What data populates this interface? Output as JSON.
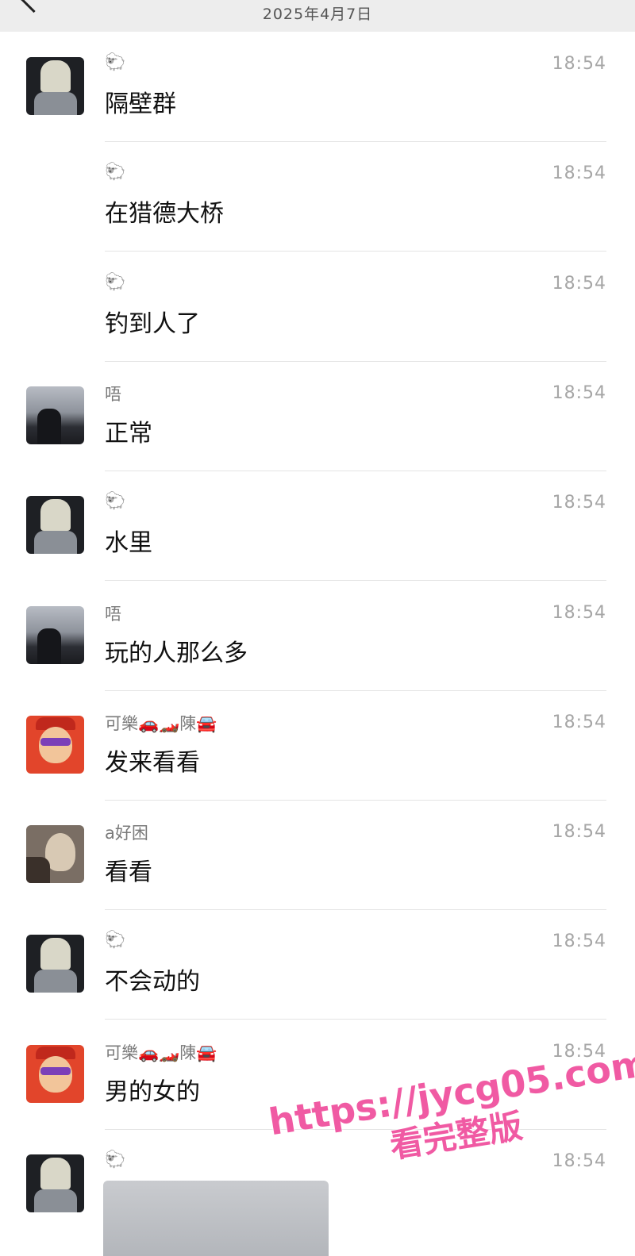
{
  "header": {
    "date": "2025年4月7日"
  },
  "messages": [
    {
      "sender": "🐑",
      "time": "18:54",
      "text": "隔壁群",
      "avatar": "blond",
      "show_avatar": true
    },
    {
      "sender": "🐑",
      "time": "18:54",
      "text": "在猎德大桥",
      "avatar": "blond",
      "show_avatar": false
    },
    {
      "sender": "🐑",
      "time": "18:54",
      "text": "钓到人了",
      "avatar": "blond",
      "show_avatar": false
    },
    {
      "sender": "唔",
      "time": "18:54",
      "text": "正常",
      "avatar": "dark",
      "show_avatar": true
    },
    {
      "sender": "🐑",
      "time": "18:54",
      "text": "水里",
      "avatar": "blond",
      "show_avatar": true
    },
    {
      "sender": "唔",
      "time": "18:54",
      "text": "玩的人那么多",
      "avatar": "dark",
      "show_avatar": true
    },
    {
      "sender": "可樂🚗🏎️陳🚘",
      "time": "18:54",
      "text": "发来看看",
      "avatar": "red",
      "show_avatar": true
    },
    {
      "sender": "a好困",
      "time": "18:54",
      "text": "看看",
      "avatar": "cat",
      "show_avatar": true
    },
    {
      "sender": "🐑",
      "time": "18:54",
      "text": "不会动的",
      "avatar": "blond",
      "show_avatar": true
    },
    {
      "sender": "可樂🚗🏎️陳🚘",
      "time": "18:54",
      "text": "男的女的",
      "avatar": "red",
      "show_avatar": true
    },
    {
      "sender": "🐑",
      "time": "18:54",
      "text": "",
      "avatar": "blond",
      "show_avatar": true
    }
  ],
  "watermark": {
    "url": "https://jycg05.com",
    "subtitle": "看完整版"
  }
}
